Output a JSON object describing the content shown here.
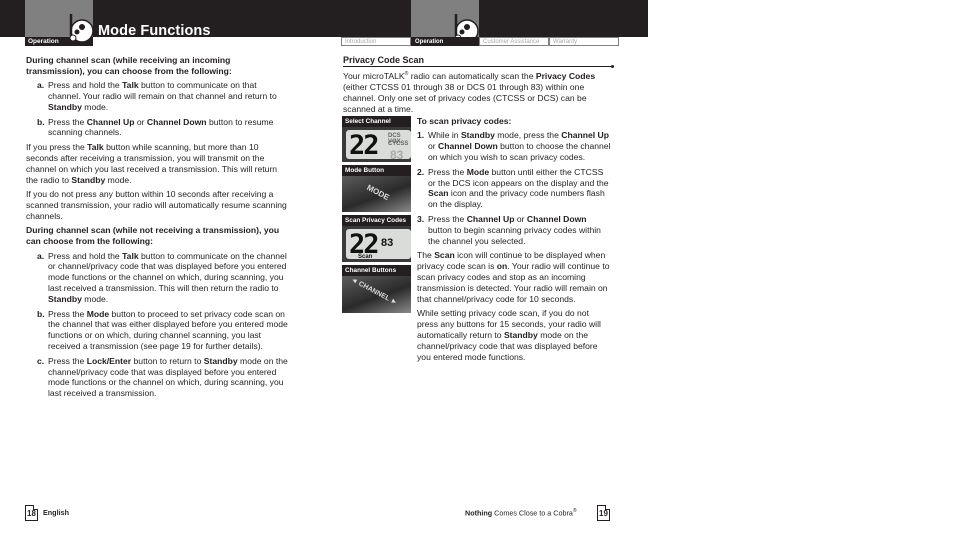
{
  "header": {
    "left_section_label": "Operation",
    "page_title": "Mode Functions",
    "tabs": [
      {
        "label": "Introduction",
        "active": false
      },
      {
        "label": "Operation",
        "active": true
      },
      {
        "label": "Customer Assistance",
        "active": false
      },
      {
        "label": "Warranty",
        "active": false
      }
    ]
  },
  "left_page": {
    "heading1": "During channel scan (while receiving an incoming transmission), you can choose from the following:",
    "list1": [
      {
        "marker": "a.",
        "parts": [
          [
            "Press and hold the ",
            false
          ],
          [
            "Talk",
            true
          ],
          [
            " button to communicate on that channel. Your radio will remain on that channel and return to ",
            false
          ],
          [
            "Standby",
            true
          ],
          [
            " mode.",
            false
          ]
        ]
      },
      {
        "marker": "b.",
        "parts": [
          [
            "Press the ",
            false
          ],
          [
            "Channel Up",
            true
          ],
          [
            " or ",
            false
          ],
          [
            "Channel Down",
            true
          ],
          [
            " button to resume scanning channels.",
            false
          ]
        ]
      }
    ],
    "para1": [
      [
        "If you press the ",
        false
      ],
      [
        "Talk",
        true
      ],
      [
        " button while scanning, but more than 10 seconds after receiving a transmission, you will transmit on the channel on which you last received a transmission. This will return the radio to ",
        false
      ],
      [
        "Standby",
        true
      ],
      [
        " mode.",
        false
      ]
    ],
    "para2": "If you do not press any button within 10 seconds after receiving a scanned transmission, your radio will automatically resume scanning channels.",
    "heading2": "During channel scan (while not receiving a transmission), you can choose from the following:",
    "list2": [
      {
        "marker": "a.",
        "parts": [
          [
            "Press and hold the ",
            false
          ],
          [
            "Talk",
            true
          ],
          [
            " button to communicate on the channel or channel/privacy code that was displayed before you entered mode functions or the channel on which, during scanning, you last received a transmission. This will then return the radio to ",
            false
          ],
          [
            "Standby",
            true
          ],
          [
            " mode.",
            false
          ]
        ]
      },
      {
        "marker": "b.",
        "parts": [
          [
            "Press the ",
            false
          ],
          [
            "Mode",
            true
          ],
          [
            " button to proceed to set privacy code scan on the channel that was either displayed before you entered mode functions or on which, during channel scanning, you last received a transmission (see page 19 for further details).",
            false
          ]
        ]
      },
      {
        "marker": "c.",
        "parts": [
          [
            "Press the ",
            false
          ],
          [
            "Lock/Enter",
            true
          ],
          [
            " button to return to ",
            false
          ],
          [
            "Standby",
            true
          ],
          [
            " mode on the channel/privacy code that was displayed before you entered mode functions or the channel on which, during scanning, you last received a transmission.",
            false
          ]
        ]
      }
    ]
  },
  "right_page": {
    "section_title": "Privacy Code Scan",
    "intro": [
      [
        "Your microTALK",
        false
      ],
      [
        "®",
        "sup"
      ],
      [
        " radio can automatically scan the ",
        false
      ],
      [
        "Privacy Codes",
        true
      ],
      [
        " (either CTCSS 01 through 38 or DCS 01 through 83) within one channel. Only one set of privacy codes (CTCSS or DCS) can be scanned at a time.",
        false
      ]
    ],
    "photos": [
      {
        "caption": "Select Channel",
        "display_channel": "22",
        "display_code": "83",
        "labels": [
          "DCS VOX",
          "CTCSS"
        ]
      },
      {
        "caption": "Mode Button",
        "button_text": "MODE"
      },
      {
        "caption": "Scan Privacy Codes",
        "display_channel": "22",
        "display_code": "83",
        "labels": [
          "Scan"
        ]
      },
      {
        "caption": "Channel Buttons",
        "button_text": "◄ CHANNEL ►"
      }
    ],
    "steps_heading": "To scan privacy codes:",
    "steps": [
      {
        "marker": "1.",
        "parts": [
          [
            "While in ",
            false
          ],
          [
            "Standby",
            true
          ],
          [
            " mode, press the ",
            false
          ],
          [
            "Channel Up",
            true
          ],
          [
            " or ",
            false
          ],
          [
            "Channel Down",
            true
          ],
          [
            " button to choose the channel on which you wish to scan privacy codes.",
            false
          ]
        ]
      },
      {
        "marker": "2.",
        "parts": [
          [
            "Press the ",
            false
          ],
          [
            "Mode",
            true
          ],
          [
            " button until either the CTCSS or the DCS icon appears on the display and the ",
            false
          ],
          [
            "Scan",
            true
          ],
          [
            " icon and the privacy code numbers flash on the display.",
            false
          ]
        ]
      },
      {
        "marker": "3.",
        "parts": [
          [
            "Press the ",
            false
          ],
          [
            "Channel Up",
            true
          ],
          [
            " or ",
            false
          ],
          [
            "Channel Down",
            true
          ],
          [
            " button to begin scanning privacy codes within the channel you selected.",
            false
          ]
        ]
      }
    ],
    "para1": [
      [
        "The ",
        false
      ],
      [
        "Scan",
        true
      ],
      [
        " icon will continue to be displayed when privacy code scan is ",
        false
      ],
      [
        "on",
        true
      ],
      [
        ". Your radio will continue to scan privacy codes and stop as an incoming transmission is detected. Your radio will remain on that channel/privacy code for 10 seconds.",
        false
      ]
    ],
    "para2": [
      [
        "While setting privacy code scan, if you do not press any buttons for 15 seconds, your radio will automatically return to ",
        false
      ],
      [
        "Standby",
        true
      ],
      [
        " mode on the channel/privacy code that was displayed before you entered mode functions.",
        false
      ]
    ]
  },
  "footer": {
    "left_page_number": "18",
    "left_language": "English",
    "right_slogan_bold": "Nothing",
    "right_slogan": " Comes Close to a Cobra",
    "right_slogan_mark": "®",
    "right_page_number": "19"
  }
}
